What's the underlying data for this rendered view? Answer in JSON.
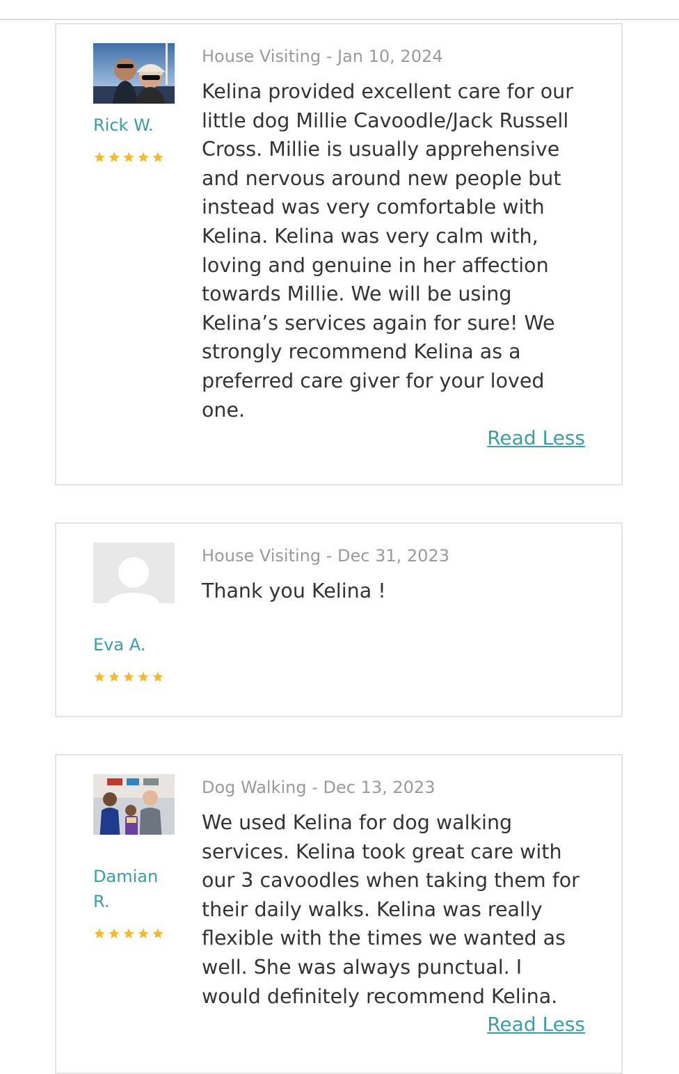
{
  "reviews": [
    {
      "reviewer": "Rick W.",
      "rating": 5,
      "service": "House Visiting",
      "date": "Jan 10, 2024",
      "meta": "House Visiting - Jan 10, 2024",
      "lines": [
        "Kelina provided excellent care for our",
        "little dog Millie Cavoodle/Jack Russell",
        "Cross. Millie is usually apprehensive",
        "and nervous around new people but",
        "instead was very comfortable with",
        "Kelina. Kelina was very calm with,",
        "loving and genuine in her affection",
        "towards Millie. We will be using",
        "Kelina’s services again for sure! We",
        "strongly recommend Kelina as a",
        "preferred care giver for your loved",
        "one."
      ],
      "toggle_label": "Read Less",
      "avatar": "photo"
    },
    {
      "reviewer": "Eva A.",
      "rating": 5,
      "service": "House Visiting",
      "date": "Dec 31, 2023",
      "meta": "House Visiting - Dec 31, 2023",
      "lines": [
        "Thank you Kelina !"
      ],
      "avatar": "default-user-icon"
    },
    {
      "reviewer": "Damian R.",
      "reviewer_lines": [
        "Damian",
        "R."
      ],
      "rating": 5,
      "service": "Dog Walking",
      "date": "Dec 13, 2023",
      "meta": "Dog Walking - Dec 13, 2023",
      "lines": [
        "We used Kelina for dog walking",
        "services. Kelina took great care with",
        "our 3 cavoodles when taking them for",
        "their daily walks. Kelina was really",
        "flexible with the times we wanted as",
        "well. She was always punctual. I",
        "would definitely recommend Kelina."
      ],
      "toggle_label": "Read Less",
      "avatar": "photo"
    }
  ],
  "colors": {
    "accent": "#3a9fa5",
    "star": "#f5b82e",
    "meta_text": "#9a9a9a",
    "body_text": "#333333",
    "card_border": "#e3e3e3"
  }
}
